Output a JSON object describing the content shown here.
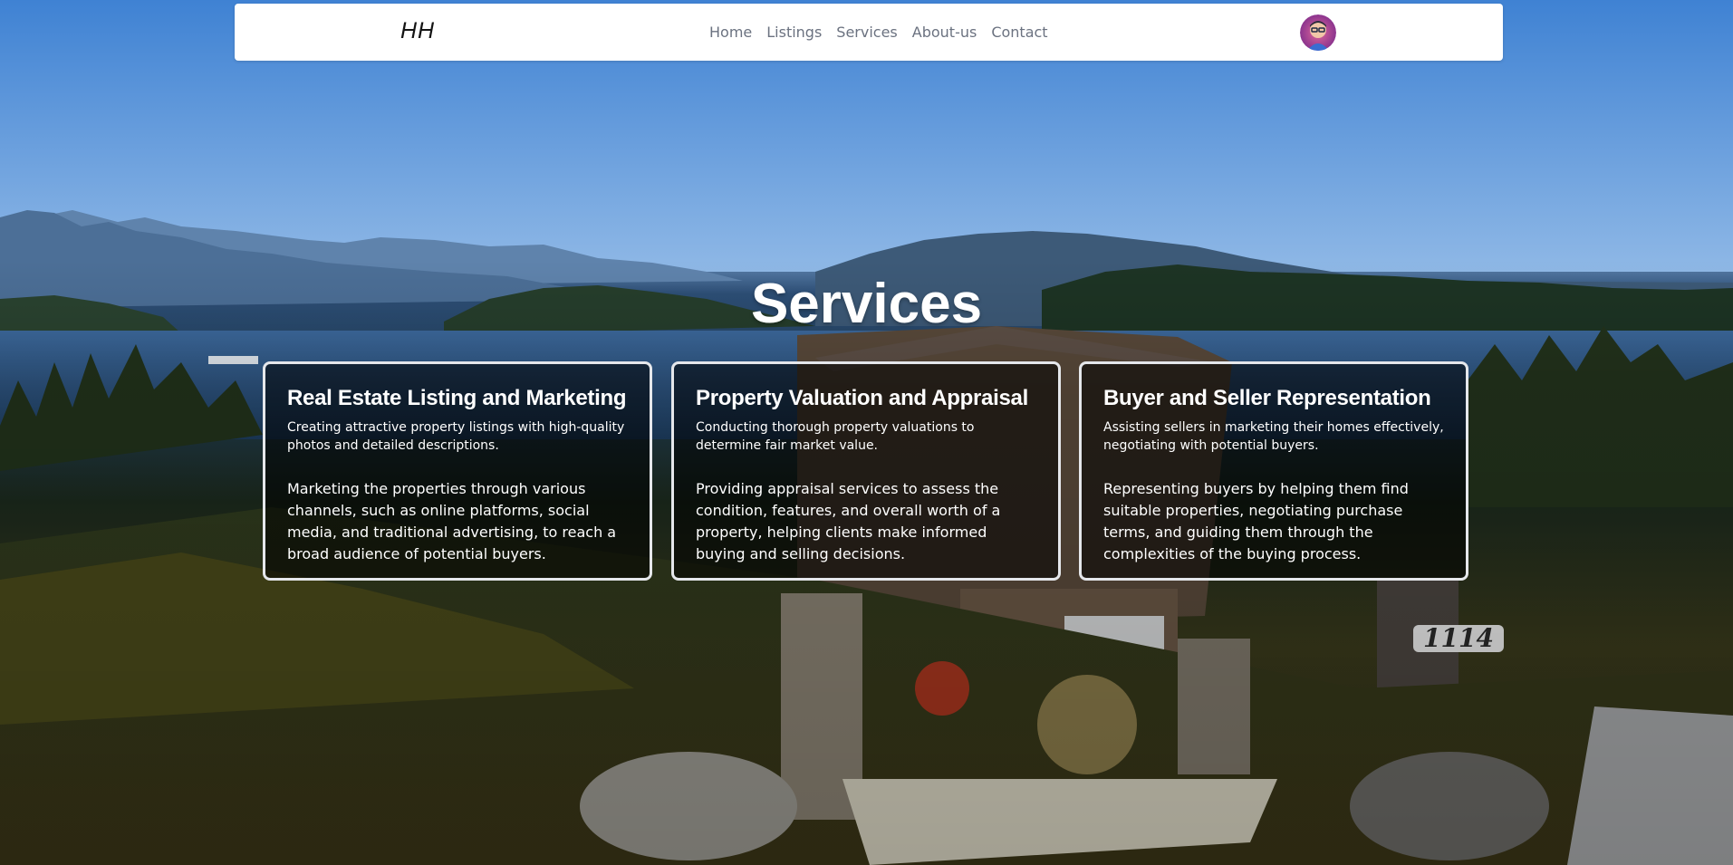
{
  "navbar": {
    "brand": "HH",
    "links": [
      "Home",
      "Listings",
      "Services",
      "About-us",
      "Contact"
    ],
    "avatar_icon": "user-avatar-icon"
  },
  "services": {
    "title": "Services",
    "cards": [
      {
        "title": "Real Estate Listing and Marketing",
        "lead": "Creating attractive property listings with high-quality photos and detailed descriptions.",
        "body": "Marketing the properties through various channels, such as online platforms, social media, and traditional advertising, to reach a broad audience of potential buyers."
      },
      {
        "title": "Property Valuation and Appraisal",
        "lead": "Conducting thorough property valuations to determine fair market value.",
        "body": "Providing appraisal services to assess the condition, features, and overall worth of a property, helping clients make informed buying and selling decisions."
      },
      {
        "title": "Buyer and Seller Representation",
        "lead": "Assisting sellers in marketing their homes effectively, negotiating with potential buyers.",
        "body": "Representing buyers by helping them find suitable properties, negotiating purchase terms, and guiding them through the complexities of the buying process."
      }
    ]
  },
  "background": {
    "house_number": "1114"
  },
  "colors": {
    "nav_text": "#6b7280",
    "card_border": "#e5e7eb",
    "sky": "#5a96d8"
  }
}
